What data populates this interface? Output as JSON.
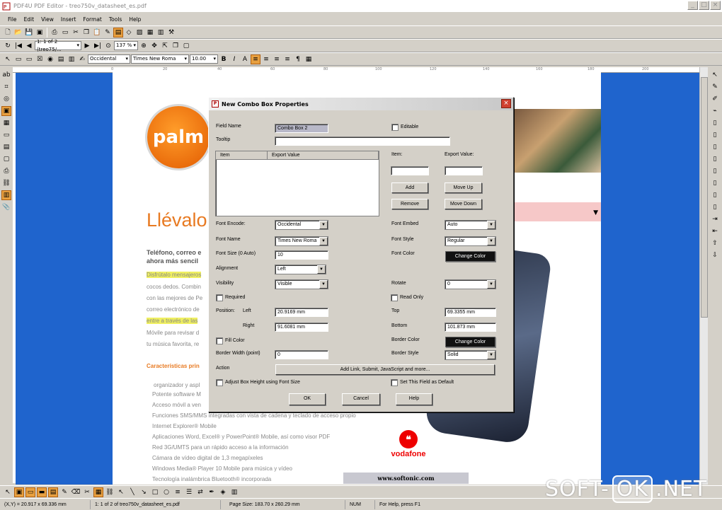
{
  "window": {
    "title": "PDF4U PDF Editor - treo750v_datasheet_es.pdf"
  },
  "menu": [
    "File",
    "Edit",
    "View",
    "Insert",
    "Format",
    "Tools",
    "Help"
  ],
  "toolbar": {
    "page_indicator": "1: 1 of 2 (treo75/...",
    "zoom": "137 %",
    "encoding": "Occidental",
    "font": "Times New Roma",
    "font_size": "10.00"
  },
  "ruler_ticks": [
    "0",
    "20",
    "40",
    "60",
    "80",
    "100",
    "120",
    "140",
    "160",
    "180",
    "200"
  ],
  "document": {
    "logo_text": "palm",
    "heading": "Llévalo",
    "intro": [
      "Teléfono, correo e",
      "ahora más sencil"
    ],
    "body_lines": [
      "Disfrútalo mensajeros",
      "cocos dedos. Combin",
      "con las mejores de Pe",
      "correo electrónico de",
      "entre a través de las",
      "Móvile para revisar d",
      "tu música favorita, re"
    ],
    "section_title": "Características prin",
    "features": [
      "organizador y aspl",
      "Potente software M",
      "Acceso móvil a ven",
      "Funciones SMS/MMS integradas con vista de cadena y teclado de acceso propio",
      "Internet Explorer® Mobile",
      "Aplicaciones Word, Excel® y PowerPoint® Mobile, así como visor PDF",
      "Red 3G/UMTS para un rápido acceso a la información",
      "Cámara de vídeo digital de 1,3 megapíxeles",
      "Windows Media® Player 10 Mobile para música y vídeo",
      "Tecnología inalámbrica Bluetooth® incorporada"
    ],
    "vodafone": "vodafone",
    "softonic": "www.softonic.com"
  },
  "dialog": {
    "title": "New Combo Box Properties",
    "field_name_label": "Field Name",
    "field_name_value": "Combo Box 2",
    "editable_label": "Editable",
    "tooltip_label": "Tooltip",
    "tooltip_value": "",
    "list_headers": [
      "Item",
      "Export Value"
    ],
    "item_label": "Item:",
    "export_value_label": "Export Value:",
    "add": "Add",
    "move_up": "Move Up",
    "remove": "Remove",
    "move_down": "Move Down",
    "font_encode_label": "Font Encode:",
    "font_encode_value": "Occidental",
    "font_embed_label": "Font Embed",
    "font_embed_value": "Auto",
    "font_name_label": "Font Name",
    "font_name_value": "Times New Roma",
    "font_style_label": "Font Style",
    "font_style_value": "Regular",
    "font_size_label": "Font Size (0 Auto)",
    "font_size_value": "10",
    "font_color_label": "Font Color",
    "change_color": "Change Color",
    "alignment_label": "Alignment",
    "alignment_value": "Left",
    "visibility_label": "Visibility",
    "visibility_value": "Visible",
    "rotate_label": "Rotate",
    "rotate_value": "0",
    "required_label": "Required",
    "read_only_label": "Read Only",
    "position_label": "Position:",
    "left_label": "Left",
    "left_value": "20.9169 mm",
    "top_label": "Top",
    "top_value": "69.3355 mm",
    "right_label": "Right",
    "right_value": "91.6081 mm",
    "bottom_label": "Bottom",
    "bottom_value": "101.873 mm",
    "fill_color_label": "Fill Color",
    "border_color_label": "Border Color",
    "border_width_label": "Border Width (point)",
    "border_width_value": "0",
    "border_style_label": "Border Style",
    "border_style_value": "Solid",
    "action_label": "Action",
    "action_button": "Add Link, Submit, JavaScript and more...",
    "adjust_label": "Adjust Box Height using Font Size",
    "default_label": "Set This Field as Default",
    "ok": "OK",
    "cancel": "Cancel",
    "help": "Help"
  },
  "status": {
    "coords": "(X,Y) = 20.917 x 69.336 mm",
    "page": "1: 1 of 2 of treo750v_datasheet_es.pdf",
    "page_size": "Page Size: 183.70 x 260.29 mm",
    "num": "NUM",
    "help": "For Help, press F1"
  },
  "watermark": {
    "left": "SOFT-",
    "box": "OK",
    "right": ".NET"
  },
  "colors": {
    "workspace": "#1f64cd",
    "palm_orange": "#e87a22",
    "highlight": "#e8a040"
  }
}
